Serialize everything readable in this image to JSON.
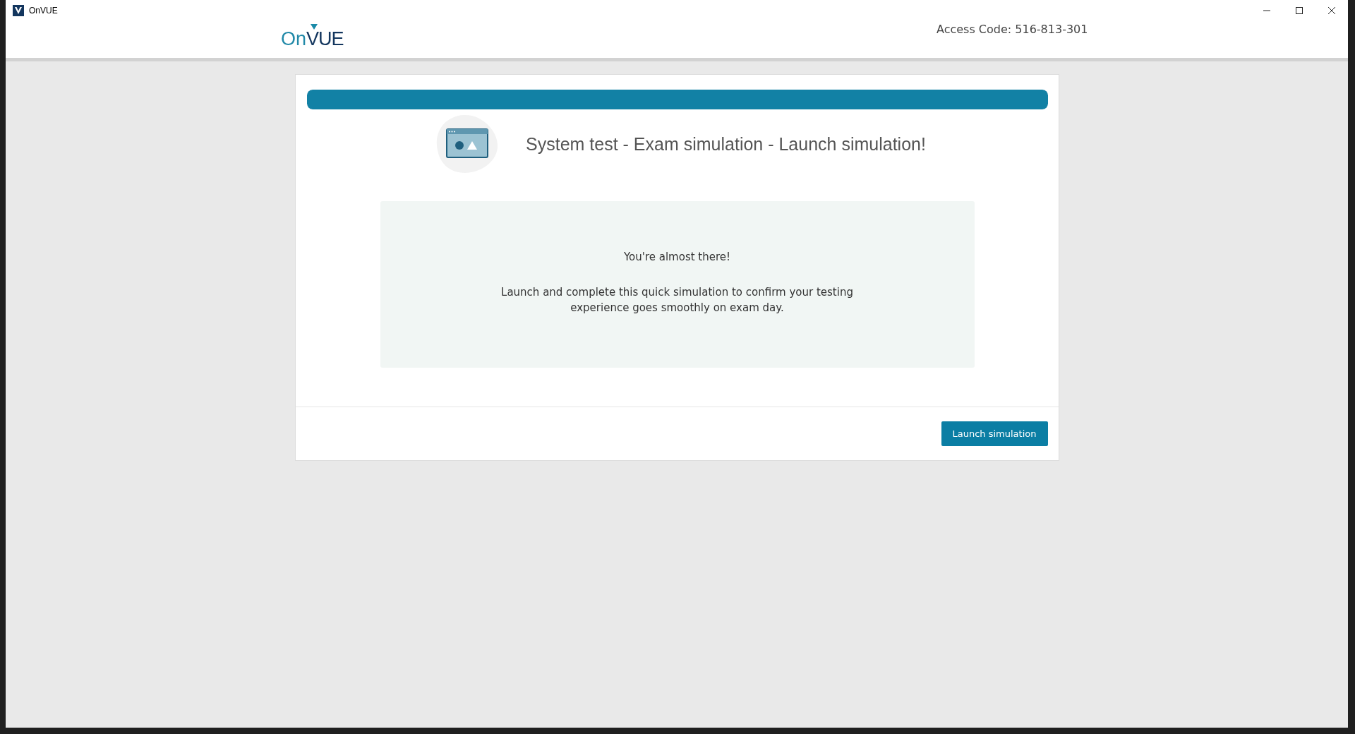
{
  "window": {
    "title": "OnVUE"
  },
  "header": {
    "logo": {
      "part_1": "On",
      "part_2": "VUE"
    },
    "access_code": "Access Code: 516-813-301"
  },
  "progress": {
    "level": 1
  },
  "step_title": "System test - Exam simulation - Launch simulation!",
  "message": {
    "heading": "You're almost there!",
    "body": "Launch and complete this quick simulation to confirm your testing experience goes smoothly on exam day."
  },
  "buttons": [
    {
      "label": "Launch simulation"
    }
  ]
}
